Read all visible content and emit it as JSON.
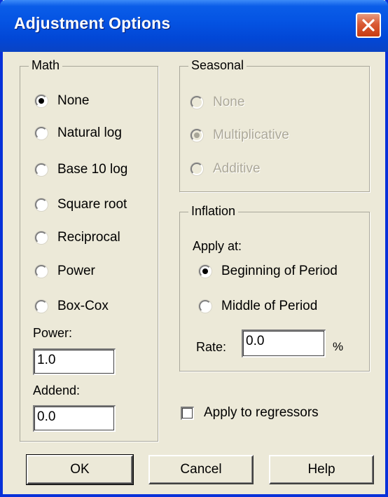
{
  "window": {
    "title": "Adjustment Options",
    "close_icon": "close-x-icon"
  },
  "math": {
    "legend": "Math",
    "options": [
      {
        "label": "None",
        "checked": true
      },
      {
        "label": "Natural log",
        "checked": false
      },
      {
        "label": "Base 10 log",
        "checked": false
      },
      {
        "label": "Square root",
        "checked": false
      },
      {
        "label": "Reciprocal",
        "checked": false
      },
      {
        "label": "Power",
        "checked": false
      },
      {
        "label": "Box-Cox",
        "checked": false
      }
    ],
    "power_label": "Power:",
    "power_value": "1.0",
    "addend_label": "Addend:",
    "addend_value": "0.0"
  },
  "seasonal": {
    "legend": "Seasonal",
    "enabled": false,
    "options": [
      {
        "label": "None",
        "checked": false
      },
      {
        "label": "Multiplicative",
        "checked": true
      },
      {
        "label": "Additive",
        "checked": false
      }
    ]
  },
  "inflation": {
    "legend": "Inflation",
    "apply_at_label": "Apply at:",
    "options": [
      {
        "label": "Beginning of Period",
        "checked": true
      },
      {
        "label": "Middle of Period",
        "checked": false
      }
    ],
    "rate_label": "Rate:",
    "rate_value": "0.0",
    "rate_unit": "%"
  },
  "regressors": {
    "label": "Apply to regressors",
    "checked": false
  },
  "buttons": {
    "ok": "OK",
    "cancel": "Cancel",
    "help": "Help"
  }
}
